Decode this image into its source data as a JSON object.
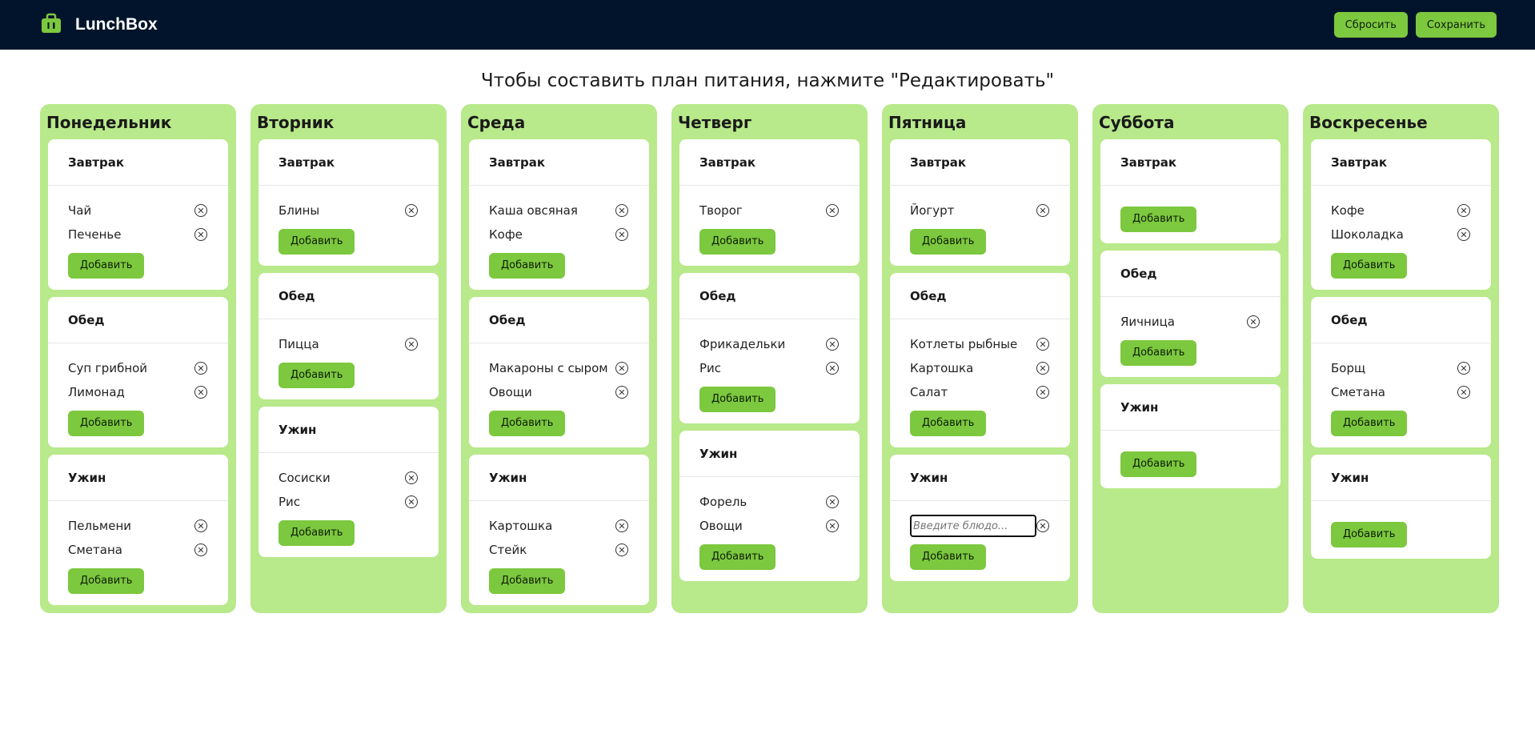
{
  "app": {
    "name": "LunchBox",
    "reset_label": "Сбросить",
    "save_label": "Сохранить"
  },
  "hint": "Чтобы составить план питания, нажмите \"Редактировать\"",
  "add_label": "Добавить",
  "days": [
    {
      "name": "Понедельник",
      "meals": [
        {
          "name": "Завтрак",
          "dishes": [
            "Чай",
            "Печенье"
          ]
        },
        {
          "name": "Обед",
          "dishes": [
            "Суп грибной",
            "Лимонад"
          ]
        },
        {
          "name": "Ужин",
          "dishes": [
            "Пельмени",
            "Сметана"
          ]
        }
      ]
    },
    {
      "name": "Вторник",
      "meals": [
        {
          "name": "Завтрак",
          "dishes": [
            "Блины"
          ]
        },
        {
          "name": "Обед",
          "dishes": [
            "Пицца"
          ]
        },
        {
          "name": "Ужин",
          "dishes": [
            "Сосиски",
            "Рис"
          ]
        }
      ]
    },
    {
      "name": "Среда",
      "meals": [
        {
          "name": "Завтрак",
          "dishes": [
            "Каша овсяная",
            "Кофе"
          ]
        },
        {
          "name": "Обед",
          "dishes": [
            "Макароны с сыром",
            "Овощи"
          ]
        },
        {
          "name": "Ужин",
          "dishes": [
            "Картошка",
            "Стейк"
          ]
        }
      ]
    },
    {
      "name": "Четверг",
      "meals": [
        {
          "name": "Завтрак",
          "dishes": [
            "Творог"
          ]
        },
        {
          "name": "Обед",
          "dishes": [
            "Фрикадельки",
            "Рис"
          ]
        },
        {
          "name": "Ужин",
          "dishes": [
            "Форель",
            "Овощи"
          ]
        }
      ]
    },
    {
      "name": "Пятница",
      "meals": [
        {
          "name": "Завтрак",
          "dishes": [
            "Йогурт"
          ]
        },
        {
          "name": "Обед",
          "dishes": [
            "Котлеты рыбные",
            "Картошка",
            "Салат"
          ]
        },
        {
          "name": "Ужин",
          "dishes": [],
          "input_placeholder": "Введите блюдо..."
        }
      ]
    },
    {
      "name": "Суббота",
      "meals": [
        {
          "name": "Завтрак",
          "dishes": []
        },
        {
          "name": "Обед",
          "dishes": [
            "Яичница"
          ]
        },
        {
          "name": "Ужин",
          "dishes": []
        }
      ]
    },
    {
      "name": "Воскресенье",
      "meals": [
        {
          "name": "Завтрак",
          "dishes": [
            "Кофе",
            "Шоколадка"
          ]
        },
        {
          "name": "Обед",
          "dishes": [
            "Борщ",
            "Сметана"
          ]
        },
        {
          "name": "Ужин",
          "dishes": []
        }
      ]
    }
  ],
  "icons": {
    "logo": "lunchbox-icon",
    "remove": "remove-icon"
  },
  "colors": {
    "header": "#02142b",
    "accent": "#7cc83e",
    "day_bg": "#b8e98a"
  }
}
